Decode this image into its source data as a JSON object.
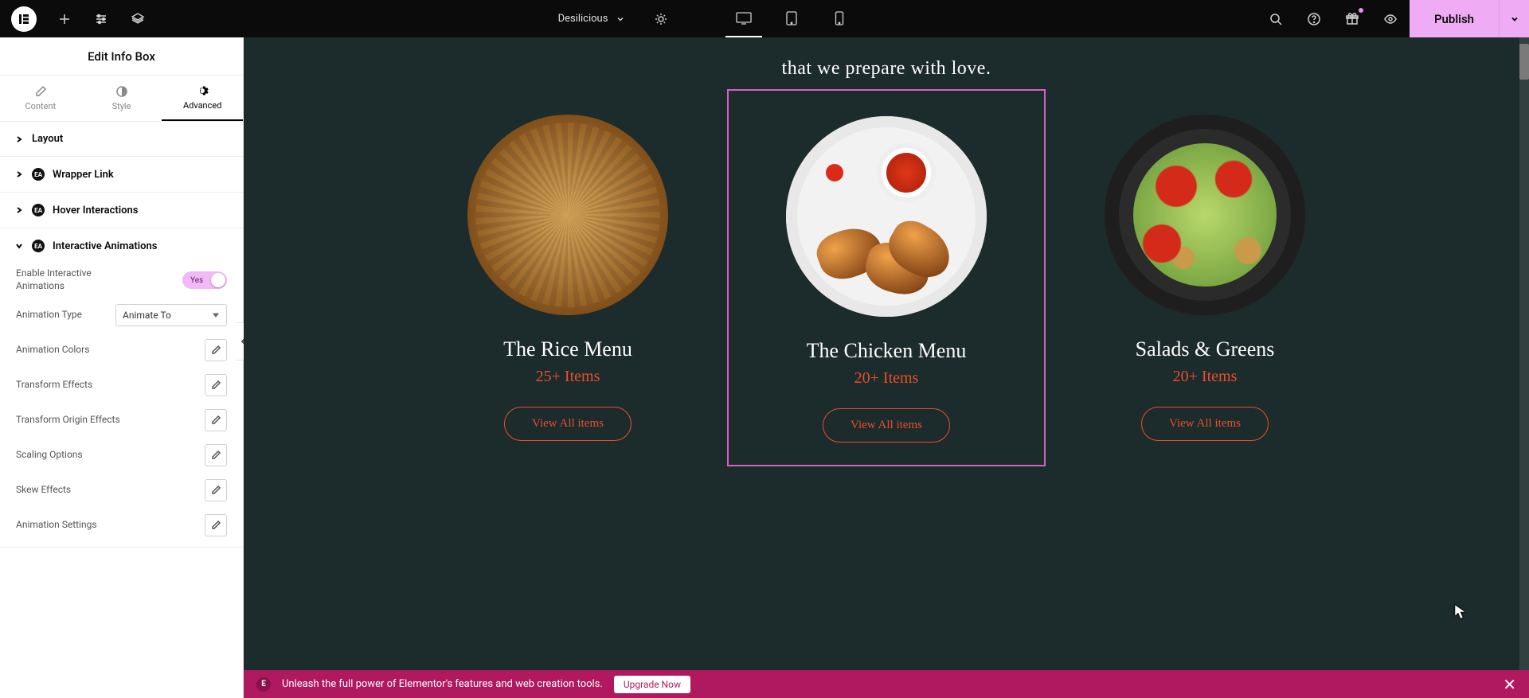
{
  "topbar": {
    "site_name": "Desilicious",
    "publish_label": "Publish"
  },
  "sidebar": {
    "title": "Edit Info Box",
    "tabs": {
      "content": "Content",
      "style": "Style",
      "advanced": "Advanced"
    },
    "sections": {
      "layout": "Layout",
      "wrapper": "Wrapper Link",
      "hover": "Hover Interactions",
      "anim": "Interactive Animations"
    },
    "anim": {
      "enable_label": "Enable Interactive Animations",
      "enable_value": "Yes",
      "type_label": "Animation Type",
      "type_value": "Animate To",
      "controls": [
        "Animation Colors",
        "Transform Effects",
        "Transform Origin Effects",
        "Scaling Options",
        "Skew Effects",
        "Animation Settings"
      ]
    }
  },
  "canvas": {
    "subtitle": "that we prepare with love.",
    "cards": [
      {
        "title": "The Rice Menu",
        "items": "25+ Items",
        "btn": "View All items"
      },
      {
        "title": "The Chicken Menu",
        "items": "20+ Items",
        "btn": "View All items"
      },
      {
        "title": "Salads & Greens",
        "items": "20+ Items",
        "btn": "View All items"
      }
    ]
  },
  "banner": {
    "text": "Unleash the full power of Elementor's features and web creation tools.",
    "cta": "Upgrade Now"
  }
}
